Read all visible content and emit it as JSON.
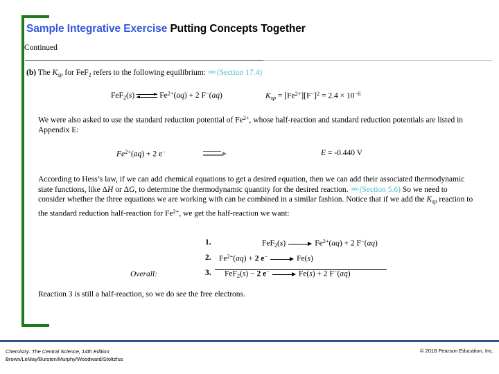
{
  "slide": {
    "title_highlight": "Sample Integrative Exercise",
    "title_rest": "Putting Concepts Together",
    "continued_label": "Continued",
    "accent_color": "#3355dd",
    "bracket_color": "#1d7a1d",
    "link_color": "#4fb9c8",
    "footer_bar_color": "#2f4f8f"
  },
  "part_b": {
    "marker": "(b)",
    "text_before": "The",
    "ksp_symbol": "K",
    "ksp_sub": "sp",
    "text_mid": "for FeF",
    "formula_sub": "2",
    "text_after": "refers to the following equilibrium:",
    "chain_icon": "chain-link-icon",
    "section_ref": "(Section 17.4)"
  },
  "equilibrium": {
    "left": "FeF2(s)",
    "arrow": "double-equilibrium-arrow",
    "right": "Fe2+(aq) + 2 F-(aq)",
    "ksp_expression": "Ksp = [Fe2+][F-]2 = 2.4 x 10-6",
    "ksp_value": "2.4",
    "ksp_exponent": "-6"
  },
  "paragraph_1": {
    "text": "We were also asked to use the standard reduction potential of Fe2+, whose half-reaction and standard reduction potentials are listed in Appendix E:"
  },
  "half_reaction": {
    "left": "Fe2+(aq) + 2 e-",
    "arrow": "reaction-arrow",
    "potential_symbol": "E",
    "potential_value": "= -0.440 V"
  },
  "paragraph_2": {
    "text": "According to Hess's law, if we can add chemical equations to get a desired equation, then we can add their associated thermodynamic state functions, like ΔH or ΔG, to determine the thermodynamic quantity for the desired reaction.",
    "chain_icon": "chain-link-icon",
    "section_ref": "(Section 5.6)",
    "text_continued": "So we need to consider whether the three equations we are working with can be combined in a similar fashion. Notice that if we add the Ksp reaction to the standard reduction half-reaction for Fe2+, we get the half-reaction we want:"
  },
  "equations": {
    "overall_label": "Overall:",
    "rows": [
      {
        "number": "1.",
        "reactants": "FeF2(s)",
        "products": "Fe2+(aq) + 2 F-(aq)"
      },
      {
        "number": "2.",
        "reactants": "Fe2+(aq) + 2 e-",
        "products": "Fe(s)"
      },
      {
        "number": "3.",
        "reactants": "FeF2(s) - 2 e-",
        "products": "Fe(s) + 2 F-(aq)"
      }
    ]
  },
  "paragraph_3": {
    "text": "Reaction 3 is still a half-reaction, so we do see the free electrons."
  },
  "footer": {
    "line1": "Chemistry: The Central Science, 14th Edition",
    "line2": "Brown/LeMay/Bursten/Murphy/Woodward/Stoltzfus",
    "copyright": "© 2018 Pearson Education, Inc."
  }
}
